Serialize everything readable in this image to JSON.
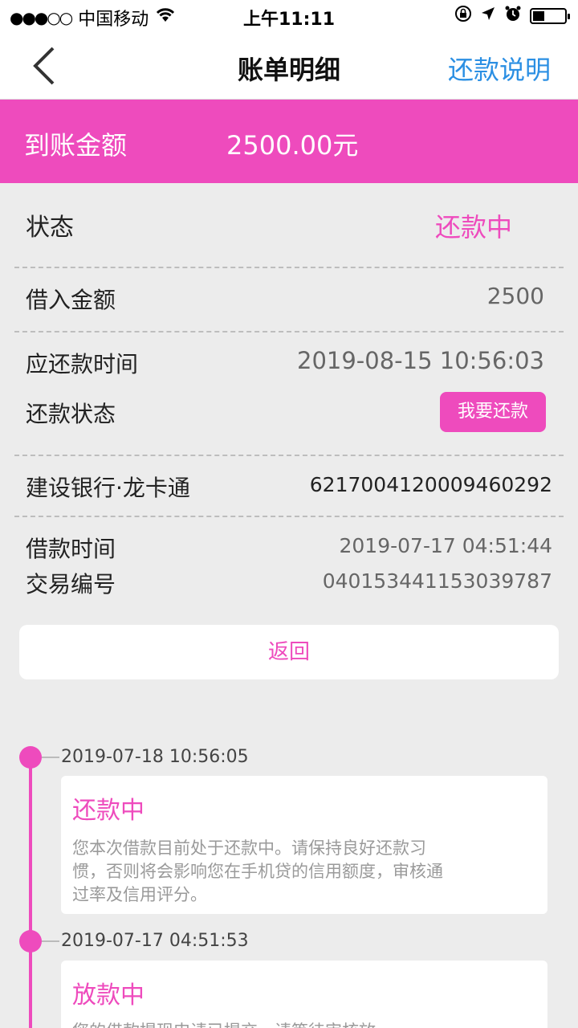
{
  "status_bar": {
    "carrier": "中国移动",
    "time": "上午11:11",
    "icons": [
      "signal-dots-icon",
      "wifi-icon",
      "orientation-lock-icon",
      "location-icon",
      "alarm-icon",
      "battery-icon"
    ]
  },
  "nav": {
    "back_icon": "chevron-left-icon",
    "title": "账单明细",
    "right_link": "还款说明"
  },
  "banner": {
    "label": "到账金额",
    "value": "2500.00元"
  },
  "details": {
    "status_label": "状态",
    "status_value": "还款中",
    "borrow_amount_label": "借入金额",
    "borrow_amount_value": "2500",
    "due_time_label": "应还款时间",
    "due_time_value": "2019-08-15 10:56:03",
    "repay_status_label": "还款状态",
    "repay_button": "我要还款",
    "bank_label": "建设银行·龙卡通",
    "bank_card": "6217004120009460292",
    "loan_time_label": "借款时间",
    "loan_time_value": "2019-07-17 04:51:44",
    "trade_no_label": "交易编号",
    "trade_no_value": "040153441153039787"
  },
  "return_button": "返回",
  "timeline": [
    {
      "time": "2019-07-18 10:56:05",
      "title": "还款中",
      "desc": "您本次借款目前处于还款中。请保持良好还款习惯，否则将会影响您在手机贷的信用额度，审核通过率及信用评分。"
    },
    {
      "time": "2019-07-17 04:51:53",
      "title": "放款中",
      "desc": "您的借款提现申请已提交，请等待审核放"
    }
  ],
  "colors": {
    "accent": "#ee4bbd",
    "link": "#2b8fe3",
    "background": "#ececec"
  }
}
